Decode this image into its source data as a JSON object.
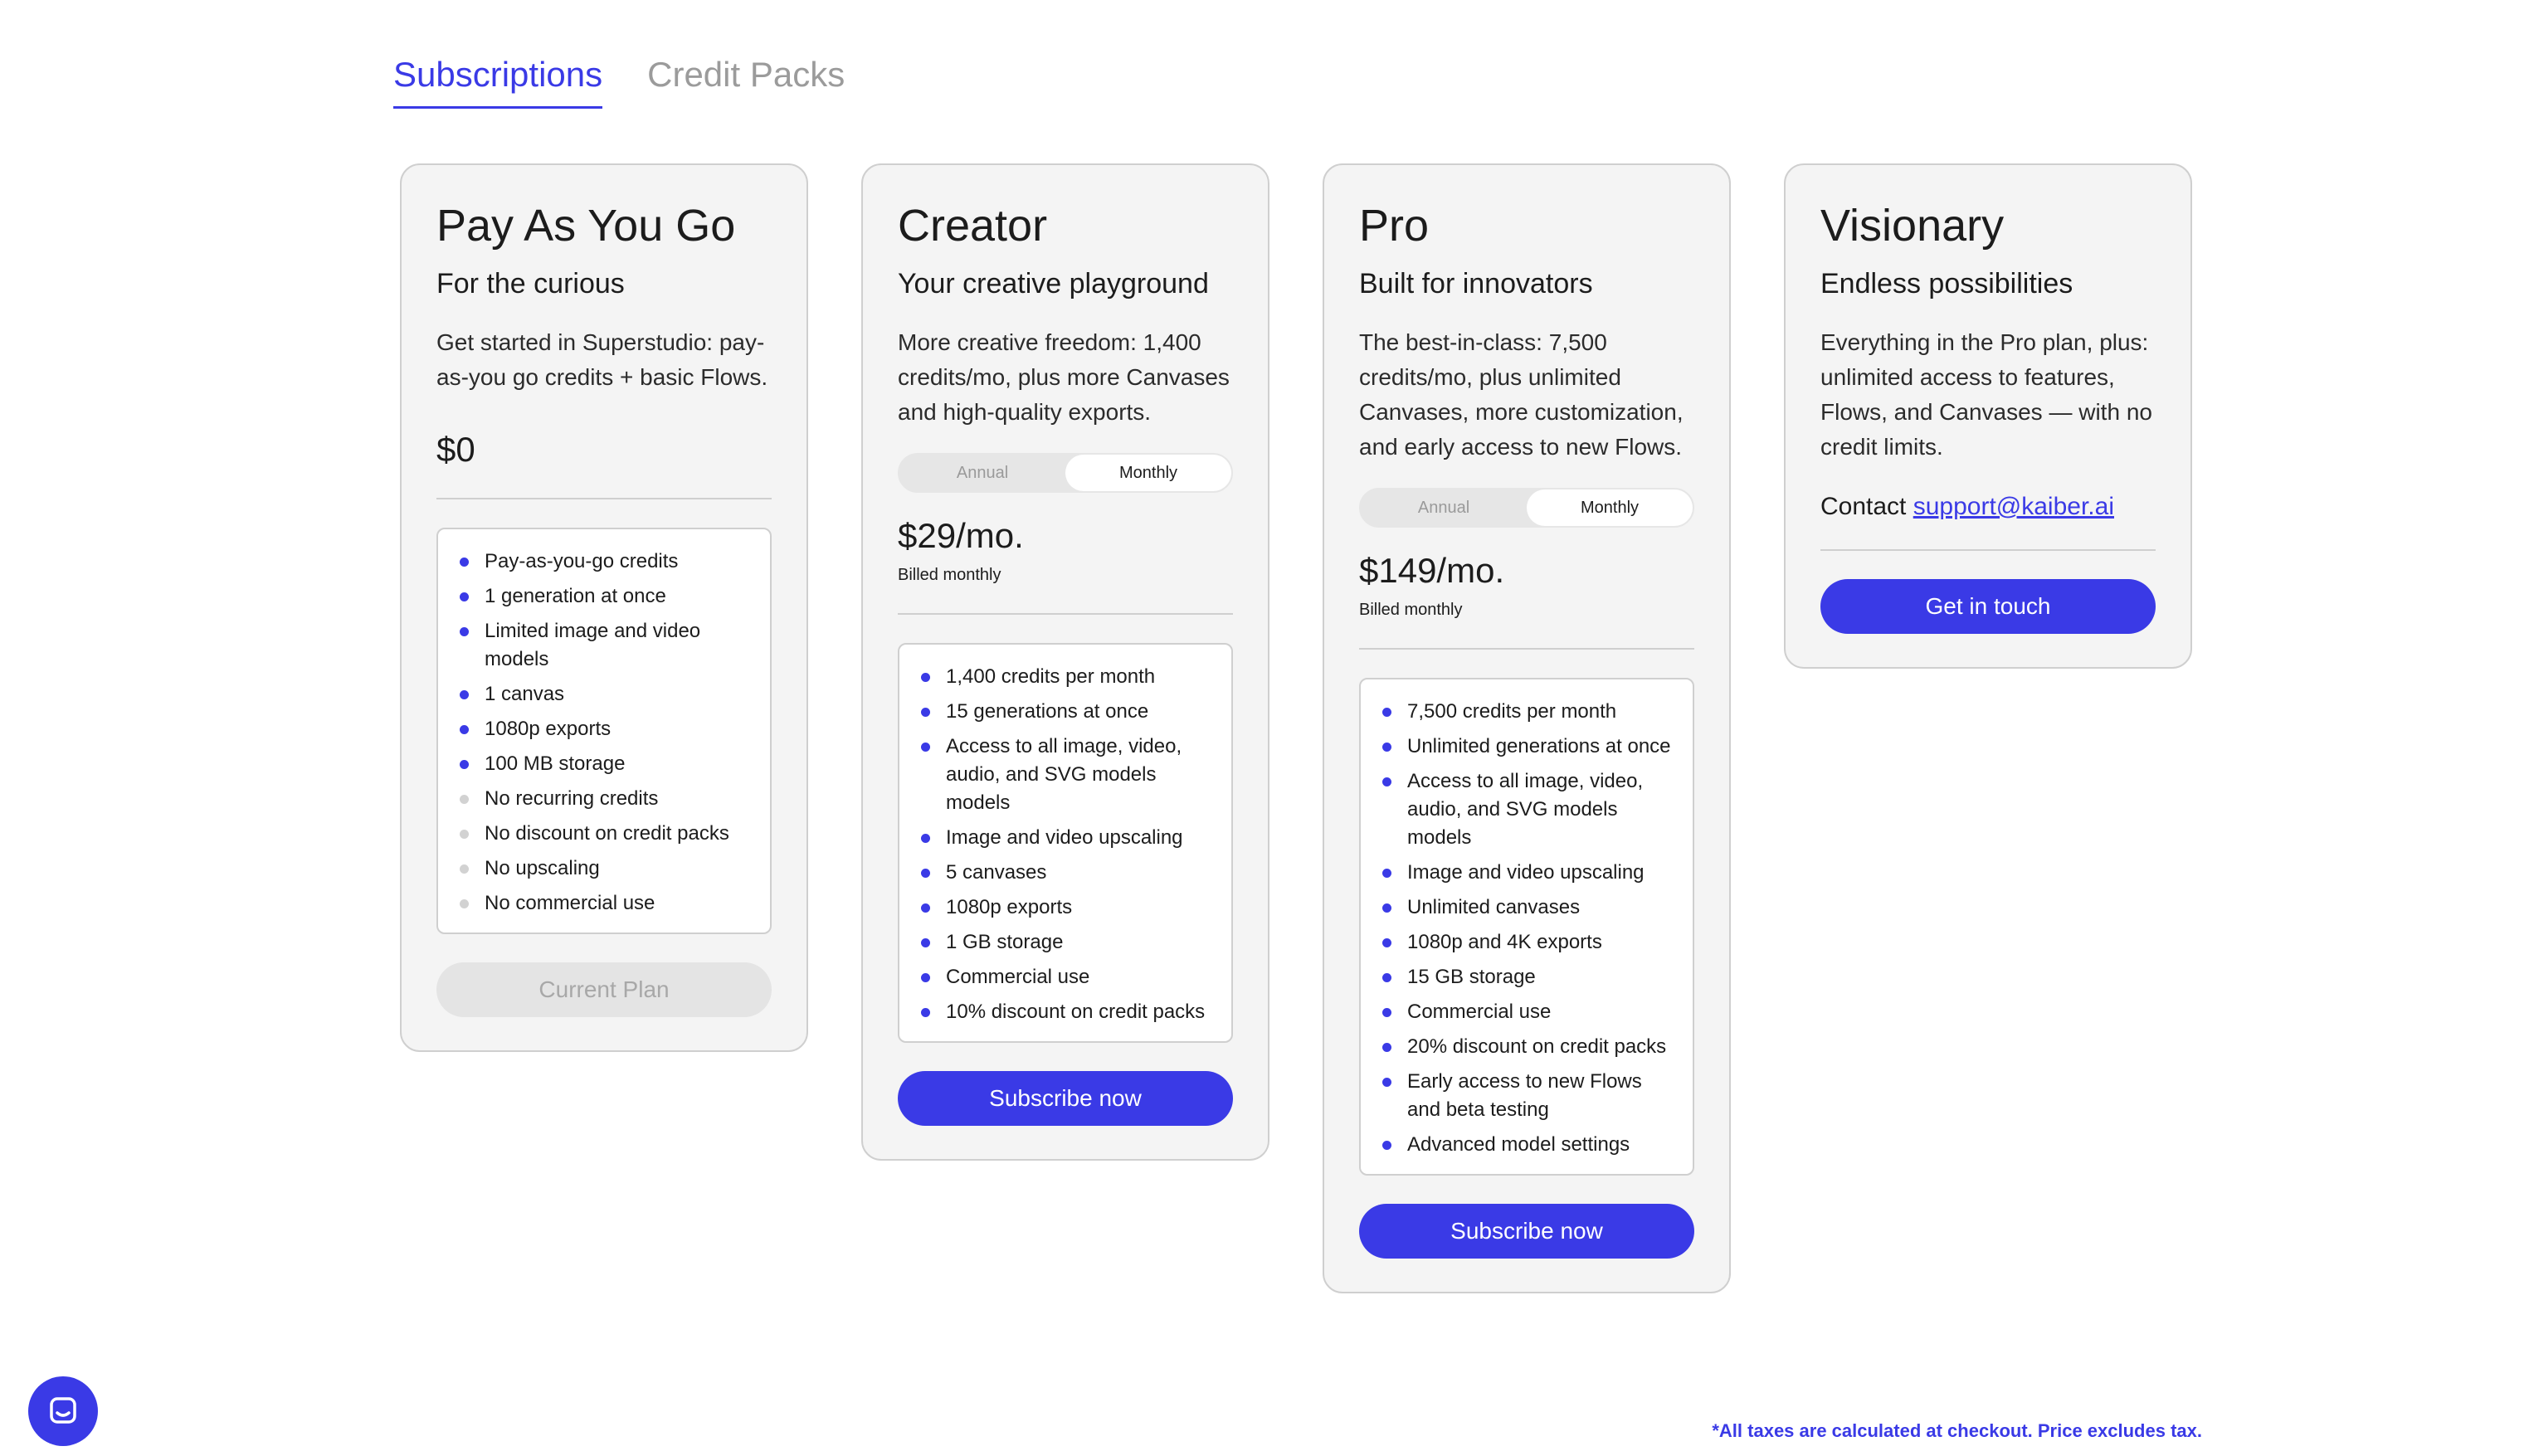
{
  "tabs": [
    {
      "label": "Subscriptions",
      "active": true
    },
    {
      "label": "Credit Packs",
      "active": false
    }
  ],
  "plans": [
    {
      "title": "Pay As You Go",
      "subtitle": "For the curious",
      "description": "Get started in Superstudio: pay-as-you go credits + basic Flows.",
      "price": "$0",
      "features": [
        {
          "text": "Pay-as-you-go credits",
          "included": true
        },
        {
          "text": "1 generation at once",
          "included": true
        },
        {
          "text": "Limited image and video models",
          "included": true
        },
        {
          "text": "1 canvas",
          "included": true
        },
        {
          "text": "1080p exports",
          "included": true
        },
        {
          "text": "100 MB storage",
          "included": true
        },
        {
          "text": "No recurring credits",
          "included": false
        },
        {
          "text": "No discount on credit packs",
          "included": false
        },
        {
          "text": "No upscaling",
          "included": false
        },
        {
          "text": "No commercial use",
          "included": false
        }
      ],
      "button": "Current Plan"
    },
    {
      "title": "Creator",
      "subtitle": "Your creative playground",
      "description": "More creative freedom: 1,400 credits/mo, plus more Canvases and high-quality exports.",
      "toggle": {
        "annual": "Annual",
        "monthly": "Monthly",
        "selected": "Monthly"
      },
      "price": "$29/mo.",
      "billed": "Billed monthly",
      "features": [
        "1,400 credits per month",
        "15 generations at once",
        "Access to all image, video, audio, and SVG models models",
        "Image and video upscaling",
        "5 canvases",
        "1080p exports",
        "1 GB storage",
        "Commercial use",
        "10% discount on credit packs"
      ],
      "button": "Subscribe now"
    },
    {
      "title": "Pro",
      "subtitle": "Built for innovators",
      "description": "The best-in-class: 7,500 credits/mo, plus unlimited Canvases, more customization, and early access to new Flows.",
      "toggle": {
        "annual": "Annual",
        "monthly": "Monthly",
        "selected": "Monthly"
      },
      "price": "$149/mo.",
      "billed": "Billed monthly",
      "features": [
        "7,500 credits per month",
        "Unlimited generations at once",
        "Access to all image, video, audio, and SVG models models",
        "Image and video upscaling",
        "Unlimited canvases",
        "1080p and 4K exports",
        "15 GB storage",
        "Commercial use",
        "20% discount on credit packs",
        "Early access to new Flows and beta testing",
        "Advanced model settings"
      ],
      "button": "Subscribe now"
    },
    {
      "title": "Visionary",
      "subtitle": "Endless possibilities",
      "description": "Everything in the Pro plan, plus: unlimited access to features, Flows, and Canvases — with no credit limits.",
      "contact_prefix": "Contact",
      "contact_email": "support@kaiber.ai",
      "button": "Get in touch"
    }
  ],
  "footnote": "*All taxes are calculated at checkout. Price excludes tax.",
  "chat_icon": "chat-bubble-icon",
  "colors": {
    "accent": "#3a3ae6",
    "card_bg": "#f4f4f4",
    "muted": "#d2d2d2"
  }
}
